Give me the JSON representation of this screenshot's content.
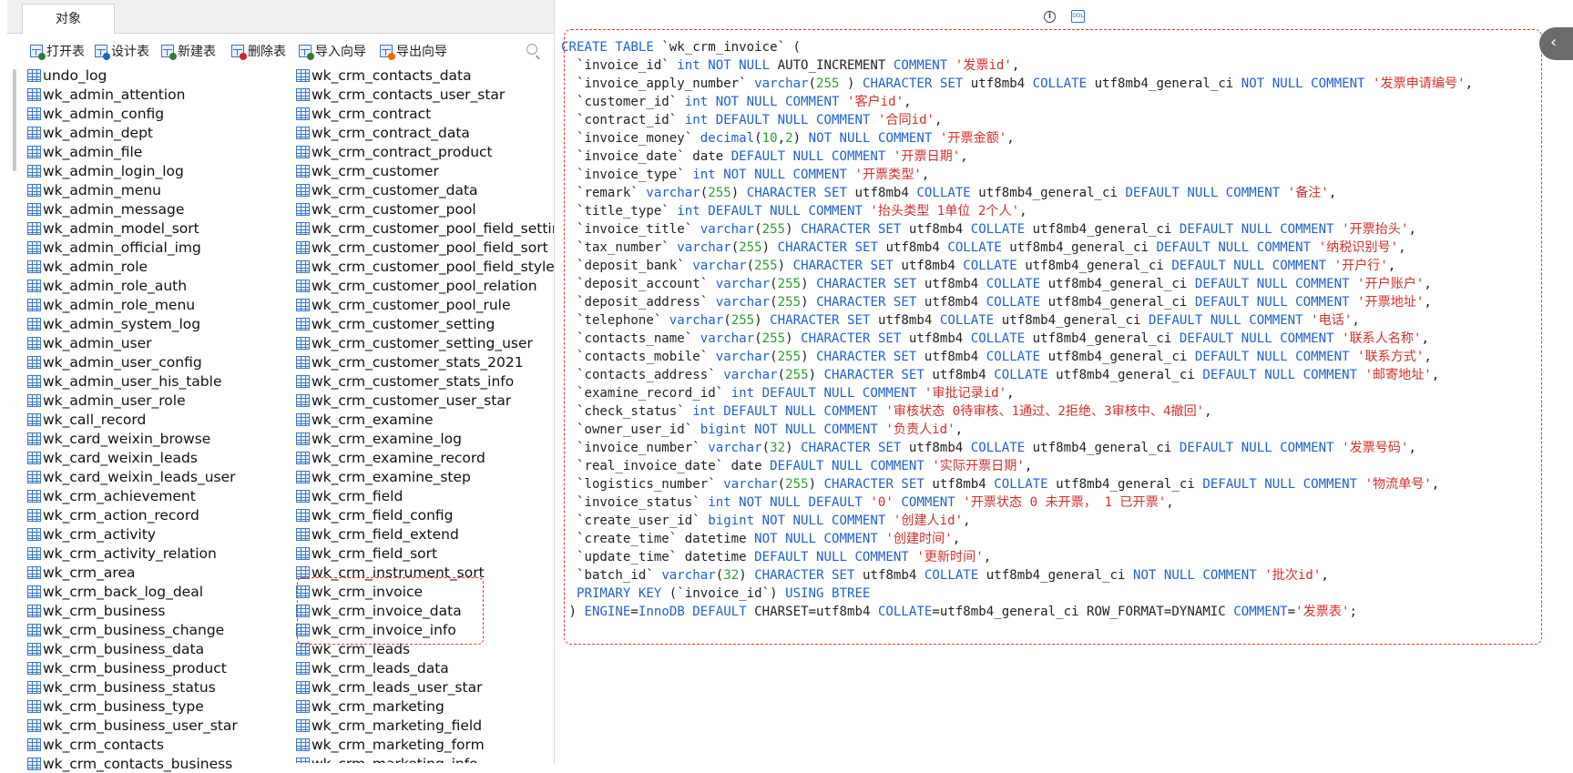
{
  "tab": {
    "label": "对象"
  },
  "toolbar": {
    "items": [
      {
        "label": "打开表",
        "icon": "open-table-icon"
      },
      {
        "label": "设计表",
        "icon": "design-table-icon"
      },
      {
        "label": "新建表",
        "icon": "new-table-icon"
      },
      {
        "label": "删除表",
        "icon": "delete-table-icon"
      },
      {
        "label": "导入向导",
        "icon": "import-wizard-icon"
      },
      {
        "label": "导出向导",
        "icon": "export-wizard-icon"
      }
    ]
  },
  "tables_col1": [
    "undo_log",
    "wk_admin_attention",
    "wk_admin_config",
    "wk_admin_dept",
    "wk_admin_file",
    "wk_admin_login_log",
    "wk_admin_menu",
    "wk_admin_message",
    "wk_admin_model_sort",
    "wk_admin_official_img",
    "wk_admin_role",
    "wk_admin_role_auth",
    "wk_admin_role_menu",
    "wk_admin_system_log",
    "wk_admin_user",
    "wk_admin_user_config",
    "wk_admin_user_his_table",
    "wk_admin_user_role",
    "wk_call_record",
    "wk_card_weixin_browse",
    "wk_card_weixin_leads",
    "wk_card_weixin_leads_user",
    "wk_crm_achievement",
    "wk_crm_action_record",
    "wk_crm_activity",
    "wk_crm_activity_relation",
    "wk_crm_area",
    "wk_crm_back_log_deal",
    "wk_crm_business",
    "wk_crm_business_change",
    "wk_crm_business_data",
    "wk_crm_business_product",
    "wk_crm_business_status",
    "wk_crm_business_type",
    "wk_crm_business_user_star",
    "wk_crm_contacts",
    "wk_crm_contacts_business"
  ],
  "tables_col2": [
    "wk_crm_contacts_data",
    "wk_crm_contacts_user_star",
    "wk_crm_contract",
    "wk_crm_contract_data",
    "wk_crm_contract_product",
    "wk_crm_customer",
    "wk_crm_customer_data",
    "wk_crm_customer_pool",
    "wk_crm_customer_pool_field_setting",
    "wk_crm_customer_pool_field_sort",
    "wk_crm_customer_pool_field_style",
    "wk_crm_customer_pool_relation",
    "wk_crm_customer_pool_rule",
    "wk_crm_customer_setting",
    "wk_crm_customer_setting_user",
    "wk_crm_customer_stats_2021",
    "wk_crm_customer_stats_info",
    "wk_crm_customer_user_star",
    "wk_crm_examine",
    "wk_crm_examine_log",
    "wk_crm_examine_record",
    "wk_crm_examine_step",
    "wk_crm_field",
    "wk_crm_field_config",
    "wk_crm_field_extend",
    "wk_crm_field_sort",
    "wk_crm_instrument_sort",
    "wk_crm_invoice",
    "wk_crm_invoice_data",
    "wk_crm_invoice_info",
    "wk_crm_leads",
    "wk_crm_leads_data",
    "wk_crm_leads_user_star",
    "wk_crm_marketing",
    "wk_crm_marketing_field",
    "wk_crm_marketing_form",
    "wk_crm_marketing_info"
  ],
  "ddl_lines": [
    [
      [
        "kw",
        "CREATE TABLE "
      ],
      [
        "",
        "`wk_crm_invoice` ("
      ]
    ],
    [
      [
        "",
        "  `invoice_id` "
      ],
      [
        "kw",
        "int NOT NULL "
      ],
      [
        "",
        "AUTO_INCREMENT "
      ],
      [
        "kw",
        "COMMENT "
      ],
      [
        "str",
        "'发票id'"
      ],
      [
        "",
        ","
      ]
    ],
    [
      [
        "",
        "  `invoice_apply_number` "
      ],
      [
        "kw",
        "varchar"
      ],
      [
        "",
        "("
      ],
      [
        "num",
        "255"
      ],
      [
        "",
        " ) "
      ],
      [
        "kw",
        "CHARACTER SET "
      ],
      [
        "",
        "utf8mb4 "
      ],
      [
        "kw",
        "COLLATE "
      ],
      [
        "",
        "utf8mb4_general_ci "
      ],
      [
        "kw",
        "NOT NULL COMMENT "
      ],
      [
        "str",
        "'发票申请编号'"
      ],
      [
        "",
        ","
      ]
    ],
    [
      [
        "",
        "  `customer_id` "
      ],
      [
        "kw",
        "int NOT NULL COMMENT "
      ],
      [
        "str",
        "'客户id'"
      ],
      [
        "",
        ","
      ]
    ],
    [
      [
        "",
        "  `contract_id` "
      ],
      [
        "kw",
        "int DEFAULT NULL COMMENT "
      ],
      [
        "str",
        "'合同id'"
      ],
      [
        "",
        ","
      ]
    ],
    [
      [
        "",
        "  `invoice_money` "
      ],
      [
        "kw",
        "decimal"
      ],
      [
        "",
        "("
      ],
      [
        "num",
        "10"
      ],
      [
        "",
        ","
      ],
      [
        "num",
        "2"
      ],
      [
        "",
        ") "
      ],
      [
        "kw",
        "NOT NULL COMMENT "
      ],
      [
        "str",
        "'开票金额'"
      ],
      [
        "",
        ","
      ]
    ],
    [
      [
        "",
        "  `invoice_date` date "
      ],
      [
        "kw",
        "DEFAULT NULL COMMENT "
      ],
      [
        "str",
        "'开票日期'"
      ],
      [
        "",
        ","
      ]
    ],
    [
      [
        "",
        "  `invoice_type` "
      ],
      [
        "kw",
        "int NOT NULL COMMENT "
      ],
      [
        "str",
        "'开票类型'"
      ],
      [
        "",
        ","
      ]
    ],
    [
      [
        "",
        "  `remark` "
      ],
      [
        "kw",
        "varchar"
      ],
      [
        "",
        "("
      ],
      [
        "num",
        "255"
      ],
      [
        "",
        ") "
      ],
      [
        "kw",
        "CHARACTER SET "
      ],
      [
        "",
        "utf8mb4 "
      ],
      [
        "kw",
        "COLLATE "
      ],
      [
        "",
        "utf8mb4_general_ci "
      ],
      [
        "kw",
        "DEFAULT NULL COMMENT "
      ],
      [
        "str",
        "'备注'"
      ],
      [
        "",
        ","
      ]
    ],
    [
      [
        "",
        "  `title_type` "
      ],
      [
        "kw",
        "int DEFAULT NULL COMMENT "
      ],
      [
        "str",
        "'抬头类型 1单位 2个人'"
      ],
      [
        "",
        ","
      ]
    ],
    [
      [
        "",
        "  `invoice_title` "
      ],
      [
        "kw",
        "varchar"
      ],
      [
        "",
        "("
      ],
      [
        "num",
        "255"
      ],
      [
        "",
        ") "
      ],
      [
        "kw",
        "CHARACTER SET "
      ],
      [
        "",
        "utf8mb4 "
      ],
      [
        "kw",
        "COLLATE "
      ],
      [
        "",
        "utf8mb4_general_ci "
      ],
      [
        "kw",
        "DEFAULT NULL COMMENT "
      ],
      [
        "str",
        "'开票抬头'"
      ],
      [
        "",
        ","
      ]
    ],
    [
      [
        "",
        "  `tax_number` "
      ],
      [
        "kw",
        "varchar"
      ],
      [
        "",
        "("
      ],
      [
        "num",
        "255"
      ],
      [
        "",
        ") "
      ],
      [
        "kw",
        "CHARACTER SET "
      ],
      [
        "",
        "utf8mb4 "
      ],
      [
        "kw",
        "COLLATE "
      ],
      [
        "",
        "utf8mb4_general_ci "
      ],
      [
        "kw",
        "DEFAULT NULL COMMENT "
      ],
      [
        "str",
        "'纳税识别号'"
      ],
      [
        "",
        ","
      ]
    ],
    [
      [
        "",
        "  `deposit_bank` "
      ],
      [
        "kw",
        "varchar"
      ],
      [
        "",
        "("
      ],
      [
        "num",
        "255"
      ],
      [
        "",
        ") "
      ],
      [
        "kw",
        "CHARACTER SET "
      ],
      [
        "",
        "utf8mb4 "
      ],
      [
        "kw",
        "COLLATE "
      ],
      [
        "",
        "utf8mb4_general_ci "
      ],
      [
        "kw",
        "DEFAULT NULL COMMENT "
      ],
      [
        "str",
        "'开户行'"
      ],
      [
        "",
        ","
      ]
    ],
    [
      [
        "",
        "  `deposit_account` "
      ],
      [
        "kw",
        "varchar"
      ],
      [
        "",
        "("
      ],
      [
        "num",
        "255"
      ],
      [
        "",
        ") "
      ],
      [
        "kw",
        "CHARACTER SET "
      ],
      [
        "",
        "utf8mb4 "
      ],
      [
        "kw",
        "COLLATE "
      ],
      [
        "",
        "utf8mb4_general_ci "
      ],
      [
        "kw",
        "DEFAULT NULL COMMENT "
      ],
      [
        "str",
        "'开户账户'"
      ],
      [
        "",
        ","
      ]
    ],
    [
      [
        "",
        "  `deposit_address` "
      ],
      [
        "kw",
        "varchar"
      ],
      [
        "",
        "("
      ],
      [
        "num",
        "255"
      ],
      [
        "",
        ") "
      ],
      [
        "kw",
        "CHARACTER SET "
      ],
      [
        "",
        "utf8mb4 "
      ],
      [
        "kw",
        "COLLATE "
      ],
      [
        "",
        "utf8mb4_general_ci "
      ],
      [
        "kw",
        "DEFAULT NULL COMMENT "
      ],
      [
        "str",
        "'开票地址'"
      ],
      [
        "",
        ","
      ]
    ],
    [
      [
        "",
        "  `telephone` "
      ],
      [
        "kw",
        "varchar"
      ],
      [
        "",
        "("
      ],
      [
        "num",
        "255"
      ],
      [
        "",
        ") "
      ],
      [
        "kw",
        "CHARACTER SET "
      ],
      [
        "",
        "utf8mb4 "
      ],
      [
        "kw",
        "COLLATE "
      ],
      [
        "",
        "utf8mb4_general_ci "
      ],
      [
        "kw",
        "DEFAULT NULL COMMENT "
      ],
      [
        "str",
        "'电话'"
      ],
      [
        "",
        ","
      ]
    ],
    [
      [
        "",
        "  `contacts_name` "
      ],
      [
        "kw",
        "varchar"
      ],
      [
        "",
        "("
      ],
      [
        "num",
        "255"
      ],
      [
        "",
        ") "
      ],
      [
        "kw",
        "CHARACTER SET "
      ],
      [
        "",
        "utf8mb4 "
      ],
      [
        "kw",
        "COLLATE "
      ],
      [
        "",
        "utf8mb4_general_ci "
      ],
      [
        "kw",
        "DEFAULT NULL COMMENT "
      ],
      [
        "str",
        "'联系人名称'"
      ],
      [
        "",
        ","
      ]
    ],
    [
      [
        "",
        "  `contacts_mobile` "
      ],
      [
        "kw",
        "varchar"
      ],
      [
        "",
        "("
      ],
      [
        "num",
        "255"
      ],
      [
        "",
        ") "
      ],
      [
        "kw",
        "CHARACTER SET "
      ],
      [
        "",
        "utf8mb4 "
      ],
      [
        "kw",
        "COLLATE "
      ],
      [
        "",
        "utf8mb4_general_ci "
      ],
      [
        "kw",
        "DEFAULT NULL COMMENT "
      ],
      [
        "str",
        "'联系方式'"
      ],
      [
        "",
        ","
      ]
    ],
    [
      [
        "",
        "  `contacts_address` "
      ],
      [
        "kw",
        "varchar"
      ],
      [
        "",
        "("
      ],
      [
        "num",
        "255"
      ],
      [
        "",
        ") "
      ],
      [
        "kw",
        "CHARACTER SET "
      ],
      [
        "",
        "utf8mb4 "
      ],
      [
        "kw",
        "COLLATE "
      ],
      [
        "",
        "utf8mb4_general_ci "
      ],
      [
        "kw",
        "DEFAULT NULL COMMENT "
      ],
      [
        "str",
        "'邮寄地址'"
      ],
      [
        "",
        ","
      ]
    ],
    [
      [
        "",
        "  `examine_record_id` "
      ],
      [
        "kw",
        "int DEFAULT NULL COMMENT "
      ],
      [
        "str",
        "'审批记录id'"
      ],
      [
        "",
        ","
      ]
    ],
    [
      [
        "",
        "  `check_status` "
      ],
      [
        "kw",
        "int DEFAULT NULL COMMENT "
      ],
      [
        "str",
        "'审核状态 0待审核、1通过、2拒绝、3审核中、4撤回'"
      ],
      [
        "",
        ","
      ]
    ],
    [
      [
        "",
        "  `owner_user_id` "
      ],
      [
        "kw",
        "bigint NOT NULL COMMENT "
      ],
      [
        "str",
        "'负责人id'"
      ],
      [
        "",
        ","
      ]
    ],
    [
      [
        "",
        "  `invoice_number` "
      ],
      [
        "kw",
        "varchar"
      ],
      [
        "",
        "("
      ],
      [
        "num",
        "32"
      ],
      [
        "",
        ") "
      ],
      [
        "kw",
        "CHARACTER SET "
      ],
      [
        "",
        "utf8mb4 "
      ],
      [
        "kw",
        "COLLATE "
      ],
      [
        "",
        "utf8mb4_general_ci "
      ],
      [
        "kw",
        "DEFAULT NULL COMMENT "
      ],
      [
        "str",
        "'发票号码'"
      ],
      [
        "",
        ","
      ]
    ],
    [
      [
        "",
        "  `real_invoice_date` date "
      ],
      [
        "kw",
        "DEFAULT NULL COMMENT "
      ],
      [
        "str",
        "'实际开票日期'"
      ],
      [
        "",
        ","
      ]
    ],
    [
      [
        "",
        "  `logistics_number` "
      ],
      [
        "kw",
        "varchar"
      ],
      [
        "",
        "("
      ],
      [
        "num",
        "255"
      ],
      [
        "",
        ") "
      ],
      [
        "kw",
        "CHARACTER SET "
      ],
      [
        "",
        "utf8mb4 "
      ],
      [
        "kw",
        "COLLATE "
      ],
      [
        "",
        "utf8mb4_general_ci "
      ],
      [
        "kw",
        "DEFAULT NULL COMMENT "
      ],
      [
        "str",
        "'物流单号'"
      ],
      [
        "",
        ","
      ]
    ],
    [
      [
        "",
        "  `invoice_status` "
      ],
      [
        "kw",
        "int NOT NULL DEFAULT "
      ],
      [
        "str",
        "'0' "
      ],
      [
        "kw",
        "COMMENT "
      ],
      [
        "str",
        "'开票状态 0 未开票， 1 已开票'"
      ],
      [
        "",
        ","
      ]
    ],
    [
      [
        "",
        "  `create_user_id` "
      ],
      [
        "kw",
        "bigint NOT NULL COMMENT "
      ],
      [
        "str",
        "'创建人id'"
      ],
      [
        "",
        ","
      ]
    ],
    [
      [
        "",
        "  `create_time` datetime "
      ],
      [
        "kw",
        "NOT NULL COMMENT "
      ],
      [
        "str",
        "'创建时间'"
      ],
      [
        "",
        ","
      ]
    ],
    [
      [
        "",
        "  `update_time` datetime "
      ],
      [
        "kw",
        "DEFAULT NULL COMMENT "
      ],
      [
        "str",
        "'更新时间'"
      ],
      [
        "",
        ","
      ]
    ],
    [
      [
        "",
        "  `batch_id` "
      ],
      [
        "kw",
        "varchar"
      ],
      [
        "",
        "("
      ],
      [
        "num",
        "32"
      ],
      [
        "",
        ") "
      ],
      [
        "kw",
        "CHARACTER SET "
      ],
      [
        "",
        "utf8mb4 "
      ],
      [
        "kw",
        "COLLATE "
      ],
      [
        "",
        "utf8mb4_general_ci "
      ],
      [
        "kw",
        "NOT NULL COMMENT "
      ],
      [
        "str",
        "'批次id'"
      ],
      [
        "",
        ","
      ]
    ],
    [
      [
        "kw",
        "  PRIMARY KEY "
      ],
      [
        "",
        "(`invoice_id`) "
      ],
      [
        "kw",
        "USING BTREE"
      ]
    ],
    [
      [
        "",
        " ) "
      ],
      [
        "kw",
        "ENGINE"
      ],
      [
        "",
        "="
      ],
      [
        "kw",
        "InnoDB DEFAULT "
      ],
      [
        "",
        "CHARSET=utf8mb4 "
      ],
      [
        "kw",
        "COLLATE"
      ],
      [
        "",
        "=utf8mb4_general_ci ROW_FORMAT=DYNAMIC "
      ],
      [
        "kw",
        "COMMENT"
      ],
      [
        "",
        "="
      ],
      [
        "str",
        "'发票表'"
      ],
      [
        "",
        ";"
      ]
    ]
  ],
  "colors": {
    "keyword": "#1f5fd1",
    "string": "#d32f2f",
    "number": "#2e9d2e",
    "highlight": "#e53935"
  },
  "edge_letters": [
    "e",
    "n",
    "p",
    "g",
    "e",
    "o",
    "i",
    "e",
    "s",
    "t",
    "e",
    "e",
    "o",
    "f",
    "i",
    "i",
    "v",
    "r",
    "t",
    "e",
    "e"
  ]
}
